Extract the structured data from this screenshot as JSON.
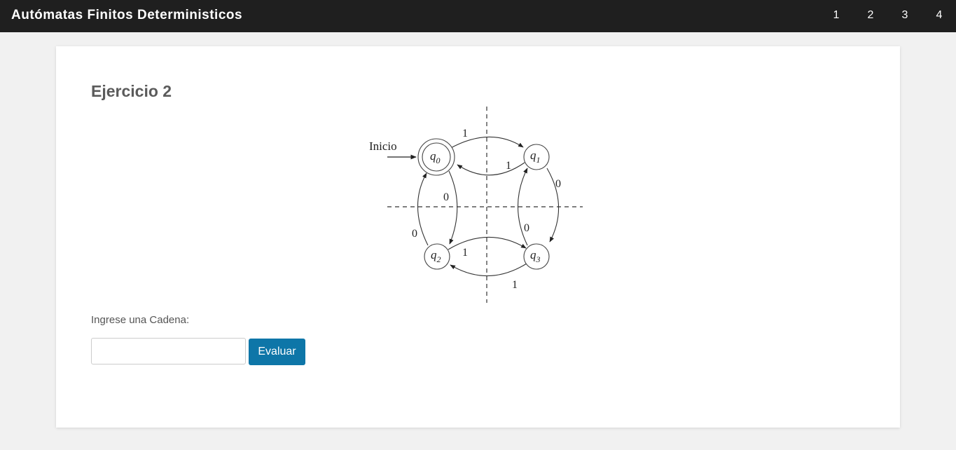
{
  "navbar": {
    "brand": "Autómatas Finitos Deterministicos",
    "links": [
      "1",
      "2",
      "3",
      "4"
    ]
  },
  "main": {
    "title": "Ejercicio 2",
    "diagram": {
      "start_label": "Inicio",
      "states": [
        {
          "name": "q",
          "sub": "0",
          "accepting": true,
          "initial": true
        },
        {
          "name": "q",
          "sub": "1",
          "accepting": false,
          "initial": false
        },
        {
          "name": "q",
          "sub": "2",
          "accepting": false,
          "initial": false
        },
        {
          "name": "q",
          "sub": "3",
          "accepting": false,
          "initial": false
        }
      ],
      "transitions": [
        {
          "from": "q0",
          "to": "q1",
          "symbol": "1"
        },
        {
          "from": "q1",
          "to": "q0",
          "symbol": "1"
        },
        {
          "from": "q0",
          "to": "q2",
          "symbol": "0"
        },
        {
          "from": "q2",
          "to": "q0",
          "symbol": "0"
        },
        {
          "from": "q1",
          "to": "q3",
          "symbol": "0"
        },
        {
          "from": "q3",
          "to": "q1",
          "symbol": "0"
        },
        {
          "from": "q2",
          "to": "q3",
          "symbol": "1"
        },
        {
          "from": "q3",
          "to": "q2",
          "symbol": "1"
        }
      ]
    },
    "input_label": "Ingrese una Cadena:",
    "input_value": "",
    "input_placeholder": "",
    "evaluate_button": "Evaluar"
  },
  "colors": {
    "navbar_bg": "#1f1f1f",
    "page_bg": "#f1f1f1",
    "button_bg": "#0e76a8"
  }
}
